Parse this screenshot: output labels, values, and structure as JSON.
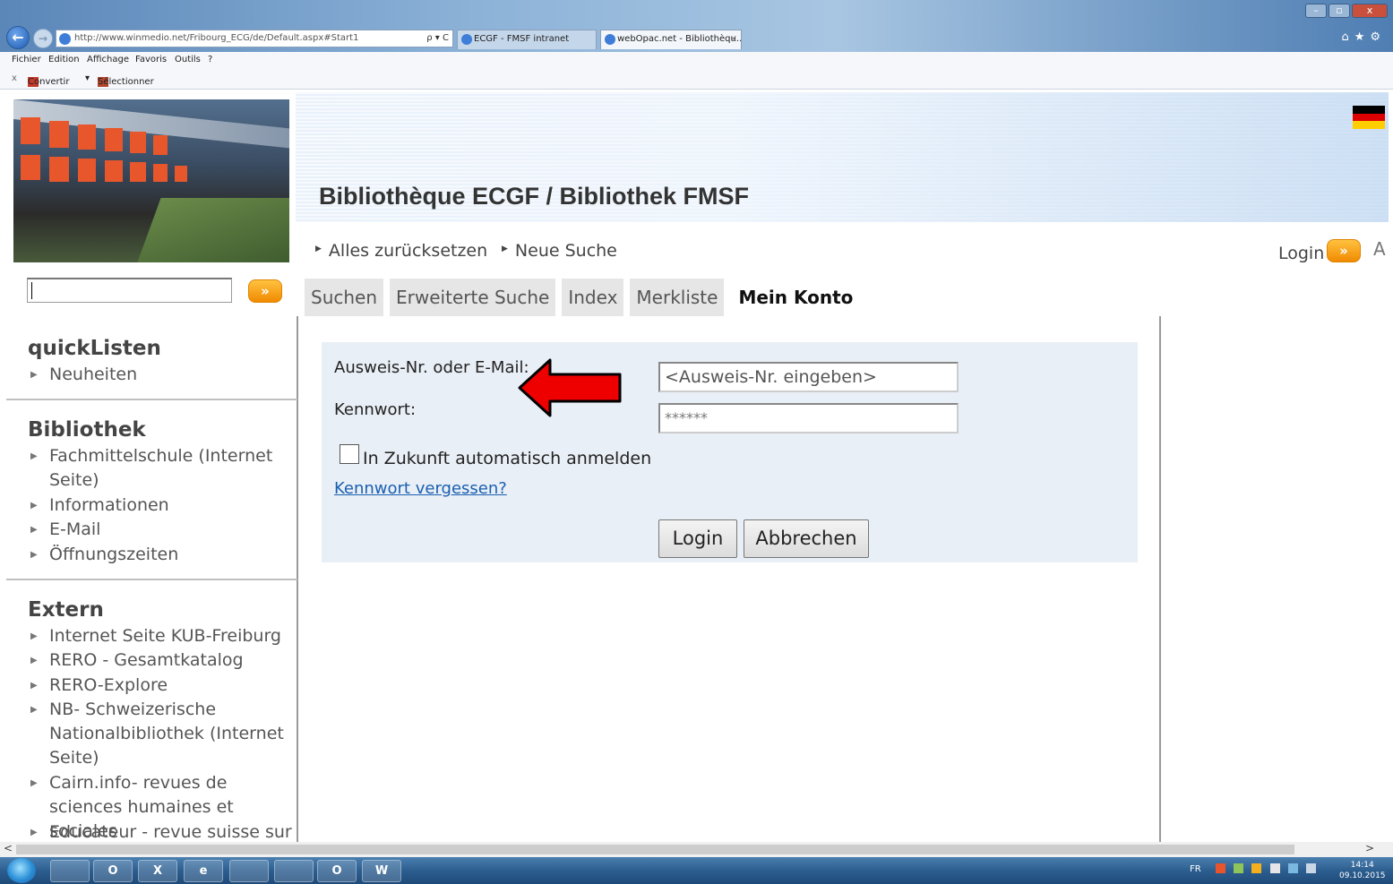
{
  "browser": {
    "url": "http://www.winmedio.net/Fribourg_ECG/de/Default.aspx#Start1",
    "address_tools": "ρ ▾ C",
    "tabs": [
      {
        "label": "ECGF - FMSF intranet"
      },
      {
        "label": "webOpac.net - Bibliothèqu...",
        "close": "×"
      }
    ],
    "window_controls": {
      "minimize": "–",
      "maximize": "▫",
      "close": "x"
    },
    "right_icons": "⌂★⚙",
    "menu": [
      "Fichier",
      "Edition",
      "Affichage",
      "Favoris",
      "Outils",
      "?"
    ],
    "command_bar": {
      "close": "x",
      "convert": "Convertir",
      "dropdown": "▾",
      "select": "Sélectionner"
    }
  },
  "site": {
    "title": "Bibliothèque ECGF / Bibliothek FMSF",
    "top_links": [
      "Alles zurücksetzen",
      "Neue Suche"
    ],
    "login_label": "Login",
    "go_glyph": "»",
    "cut_letter": "A",
    "flag_colors": [
      "#000000",
      "#dd0000",
      "#ffce00"
    ]
  },
  "tabs": [
    {
      "label": "Suchen",
      "active": false
    },
    {
      "label": "Erweiterte Suche",
      "active": false
    },
    {
      "label": "Index",
      "active": false
    },
    {
      "label": "Merkliste",
      "active": false
    },
    {
      "label": "Mein Konto",
      "active": true
    }
  ],
  "sidebar": {
    "quicklisten": {
      "heading": "quickListen",
      "items": [
        "Neuheiten"
      ]
    },
    "bibliothek": {
      "heading": "Bibliothek",
      "items": [
        "Fachmittelschule (Internet Seite)",
        "Informationen",
        "E-Mail",
        "Öffnungszeiten"
      ]
    },
    "extern": {
      "heading": "Extern",
      "items": [
        "Internet Seite KUB-Freiburg",
        "RERO - Gesamtkatalog",
        "RERO-Explore",
        "NB- Schweizerische Nationalbibliothek (Internet Seite)",
        "Cairn.info- revues de sciences humaines et sociales",
        "Educateur - revue suisse sur"
      ]
    }
  },
  "login_form": {
    "id_label": "Ausweis-Nr. oder E-Mail:",
    "id_placeholder": "<Ausweis-Nr. eingeben>",
    "password_label": "Kennwort:",
    "password_value": "******",
    "auto_login_label": "In Zukunft automatisch anmelden",
    "auto_login_checked": false,
    "forgot_link": "Kennwort vergessen?",
    "login_button": "Login",
    "cancel_button": "Abbrechen"
  },
  "scrollbar": {
    "left_arrow": "<",
    "right_arrow": ">"
  },
  "taskbar": {
    "apps": [
      "",
      "O",
      "X",
      "e",
      "",
      "",
      "O",
      "W"
    ],
    "tray_lang": "FR",
    "clock_time": "14:14",
    "clock_date": "09.10.2015"
  },
  "annotation": {
    "arrow_color": "#ee0000"
  }
}
